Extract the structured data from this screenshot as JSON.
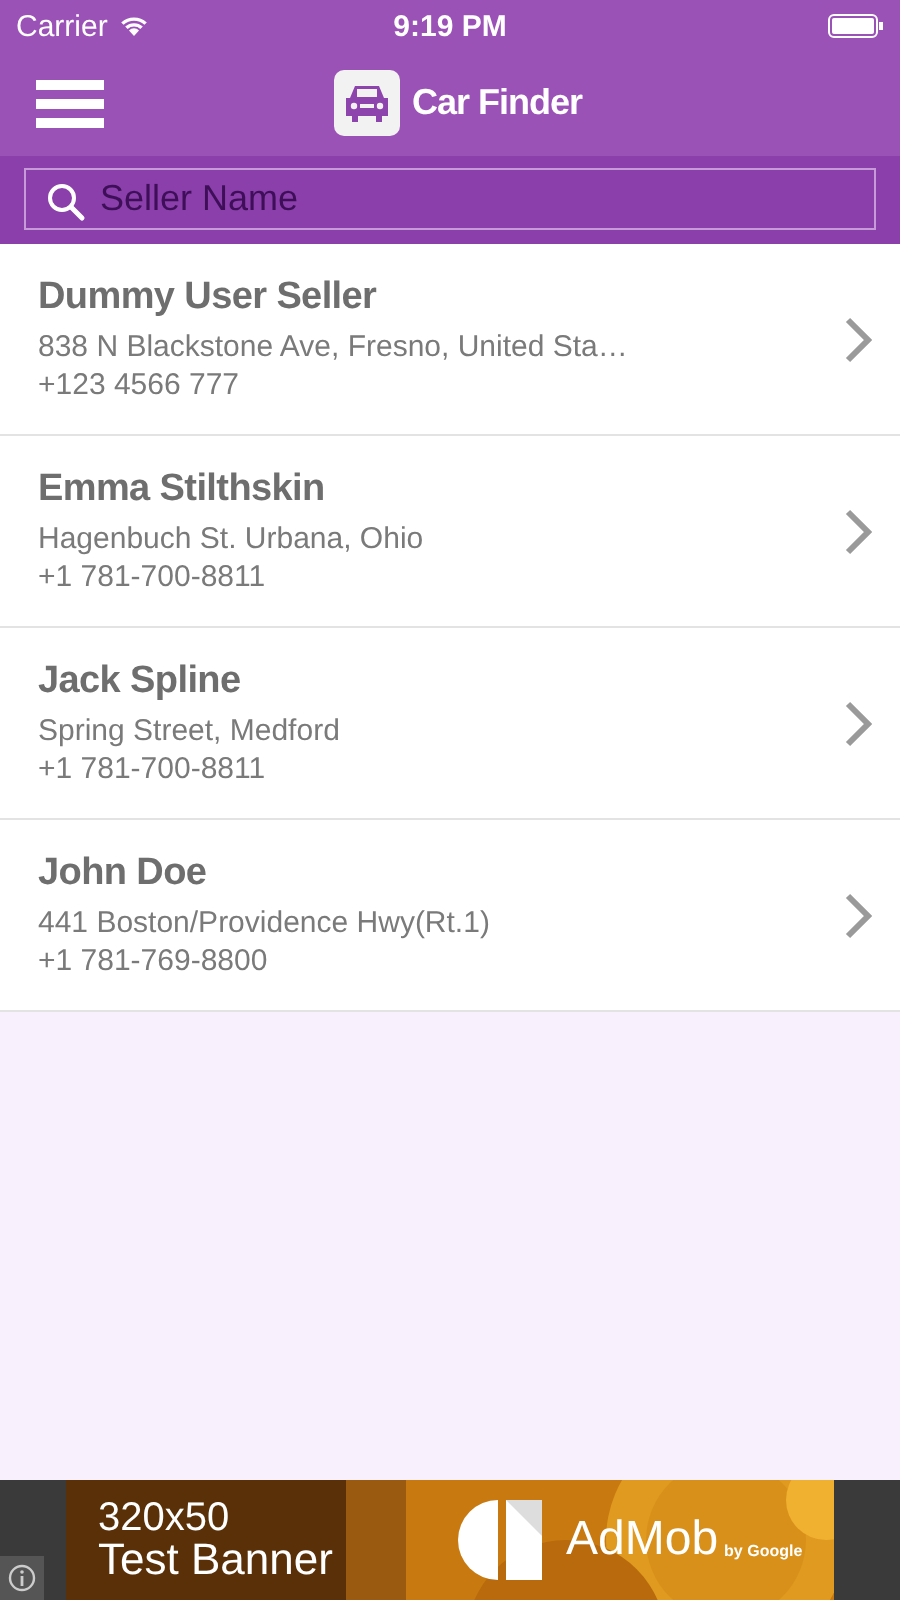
{
  "status_bar": {
    "carrier": "Carrier",
    "time": "9:19 PM"
  },
  "nav": {
    "title": "Car Finder"
  },
  "search": {
    "placeholder": "Seller Name"
  },
  "sellers": [
    {
      "name": "Dummy User Seller",
      "address": "838 N Blackstone Ave, Fresno, United Sta…",
      "phone": "+123 4566 777"
    },
    {
      "name": "Emma Stilthskin",
      "address": "Hagenbuch St. Urbana, Ohio",
      "phone": "+1 781-700-8811"
    },
    {
      "name": "Jack Spline",
      "address": "Spring Street, Medford",
      "phone": "+1 781-700-8811"
    },
    {
      "name": "John Doe",
      "address": "441 Boston/Providence Hwy(Rt.1)",
      "phone": "+1 781-769-8800"
    }
  ],
  "ad_banner": {
    "size": "320x50",
    "label": "Test Banner",
    "brand": "AdMob",
    "byline": "by Google"
  }
}
